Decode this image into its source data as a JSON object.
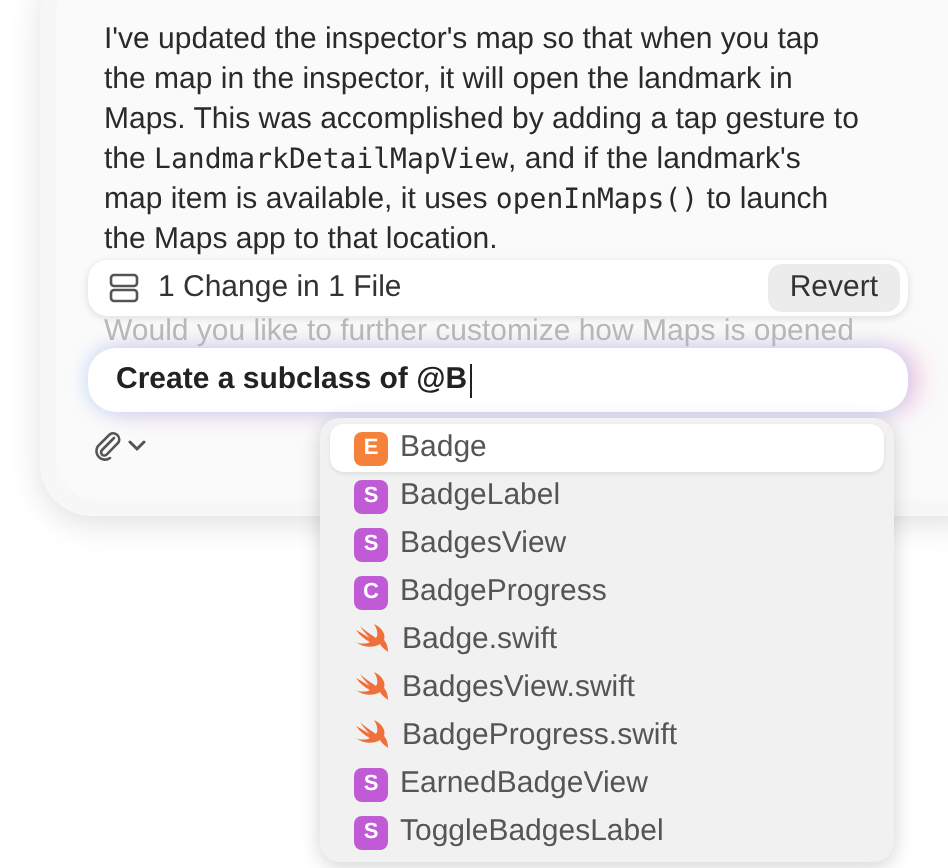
{
  "message": {
    "parts": [
      {
        "kind": "text",
        "text": "I've updated the inspector's map so that when you tap the map in the inspector, it will open the landmark in Maps. This was accomplished by adding a tap gesture to the "
      },
      {
        "kind": "code",
        "text": "LandmarkDetailMapView"
      },
      {
        "kind": "text",
        "text": ", and if the landmark's map item is available, it uses "
      },
      {
        "kind": "code",
        "text": "openInMaps()"
      },
      {
        "kind": "text",
        "text": " to launch the Maps app to that location."
      }
    ]
  },
  "changes_bar": {
    "label": "1 Change in 1 File",
    "button": "Revert"
  },
  "follow_up": "Would you like to further customize how Maps is opened",
  "prompt": {
    "value": "Create a subclass of @B"
  },
  "suggestions": [
    {
      "kind": "enum",
      "badge": "E",
      "label": "Badge",
      "selected": true
    },
    {
      "kind": "struct",
      "badge": "S",
      "label": "BadgeLabel",
      "selected": false
    },
    {
      "kind": "struct",
      "badge": "S",
      "label": "BadgesView",
      "selected": false
    },
    {
      "kind": "class",
      "badge": "C",
      "label": "BadgeProgress",
      "selected": false
    },
    {
      "kind": "file",
      "label": "Badge.swift",
      "selected": false
    },
    {
      "kind": "file",
      "label": "BadgesView.swift",
      "selected": false
    },
    {
      "kind": "file",
      "label": "BadgeProgress.swift",
      "selected": false
    },
    {
      "kind": "struct",
      "badge": "S",
      "label": "EarnedBadgeView",
      "selected": false
    },
    {
      "kind": "struct",
      "badge": "S",
      "label": "ToggleBadgesLabel",
      "selected": false
    }
  ]
}
